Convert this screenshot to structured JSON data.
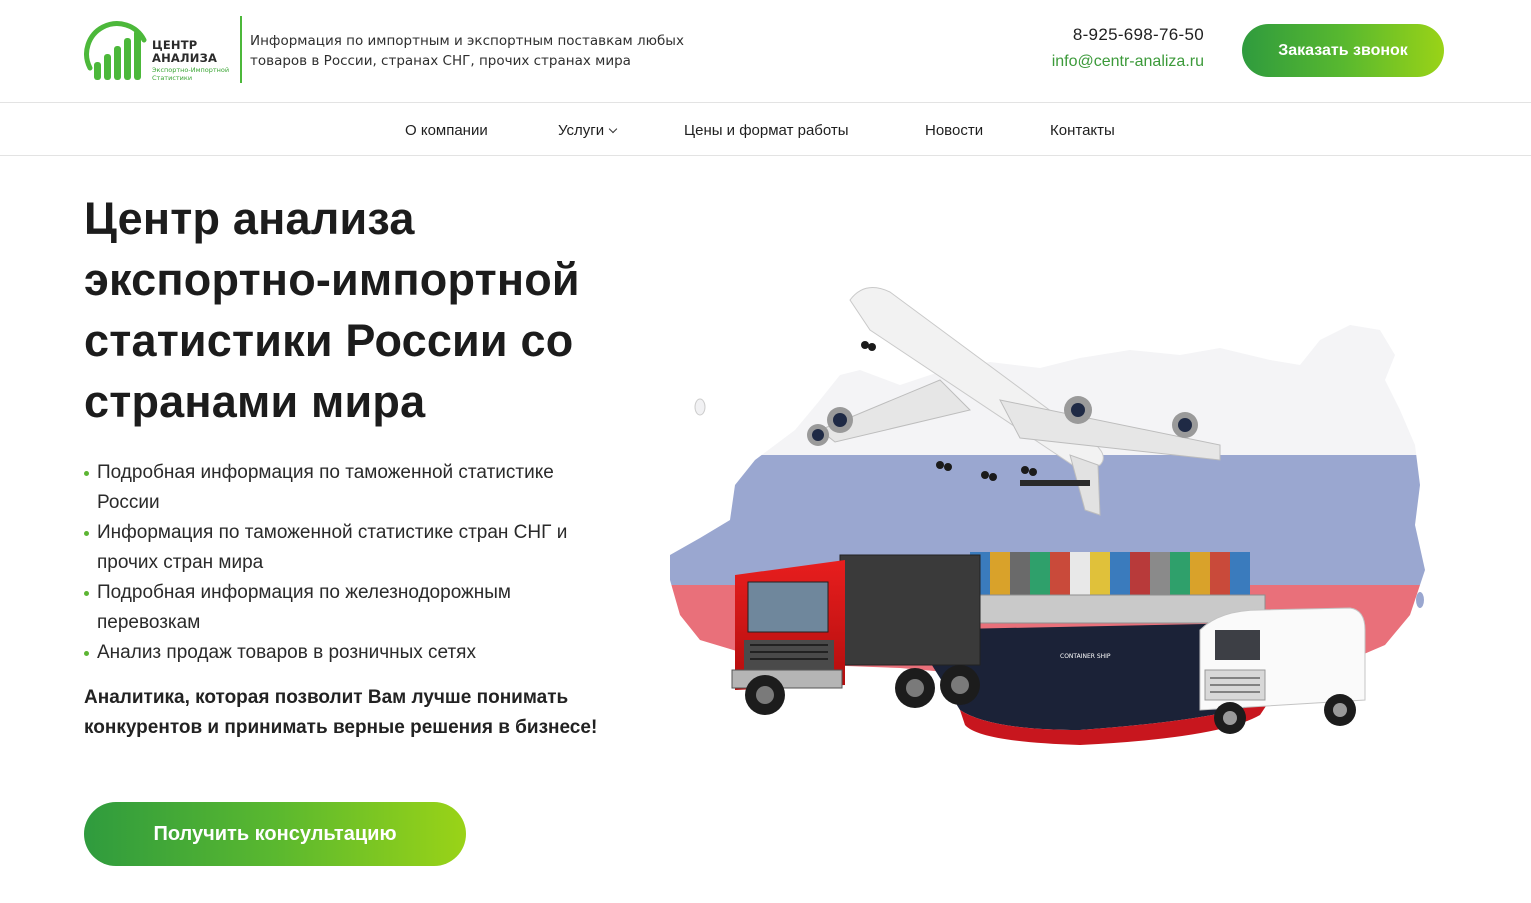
{
  "header": {
    "logo": {
      "line1": "ЦЕНТР",
      "line2": "АНАЛИЗА",
      "line3": "Экспортно-Импортной",
      "line4": "Статистики"
    },
    "tagline": "Информация по импортным и экспортным поставкам любых товаров в России, странах СНГ, прочих странах мира",
    "phone": "8-925-698-76-50",
    "email": "info@centr-analiza.ru",
    "call_button": "Заказать звонок"
  },
  "nav": {
    "items": [
      {
        "label": "О компании"
      },
      {
        "label": "Услуги"
      },
      {
        "label": "Цены и формат работы"
      },
      {
        "label": "Новости"
      },
      {
        "label": "Контакты"
      }
    ]
  },
  "hero": {
    "title_lines": [
      "Центр анализа",
      "экспортно-импортной",
      "статистики России со",
      "странами мира"
    ],
    "bullets": [
      "Подробная информация по таможенной статистике России",
      "Информация по таможенной статистике стран СНГ и прочих стран мира",
      "Подробная информация по железнодорожным перевозкам",
      "Анализ продаж товаров в розничных сетях"
    ],
    "subline": "Аналитика, которая позволит Вам лучше понимать конкурентов и принимать верные решения в бизнесе!",
    "consult_button": "Получить консультацию",
    "ship_label": "CONTAINER SHIP"
  },
  "colors": {
    "accent_green": "#4cb83a",
    "gradient_start": "#2f9b3e",
    "gradient_end": "#9ad317",
    "email_green": "#3c9a3a"
  },
  "icons": [
    "logo-chart-icon",
    "chevron-down-icon"
  ]
}
